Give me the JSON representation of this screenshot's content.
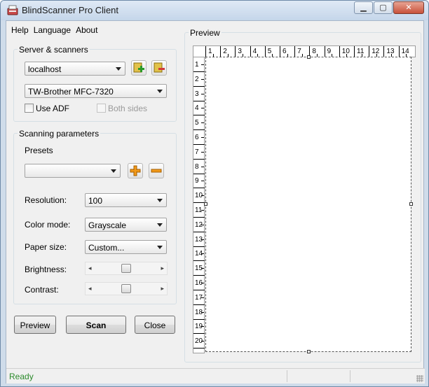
{
  "window": {
    "title": "BlindScanner Pro Client",
    "app_icon": "scanner-app-icon",
    "controls": {
      "minimize": "minimize-icon",
      "maximize": "maximize-icon",
      "close": "close-icon"
    }
  },
  "menu": {
    "items": [
      "Help",
      "Language",
      "About"
    ]
  },
  "server_group": {
    "title": "Server & scanners",
    "server_value": "localhost",
    "scanner_value": "TW-Brother MFC-7320",
    "add_server_icon": "add-server-icon",
    "remove_server_icon": "remove-server-icon",
    "use_adf_label": "Use ADF",
    "use_adf_checked": false,
    "both_sides_label": "Both sides",
    "both_sides_checked": false,
    "both_sides_enabled": false
  },
  "params_group": {
    "title": "Scanning parameters",
    "presets_label": "Presets",
    "preset_value": "",
    "add_preset_icon": "plus-icon",
    "remove_preset_icon": "minus-icon",
    "resolution_label": "Resolution:",
    "resolution_value": "100",
    "color_mode_label": "Color mode:",
    "color_mode_value": "Grayscale",
    "paper_size_label": "Paper size:",
    "paper_size_value": "Custom...",
    "brightness_label": "Brightness:",
    "brightness_level": 0.5,
    "contrast_label": "Contrast:",
    "contrast_level": 0.5
  },
  "buttons": {
    "preview": "Preview",
    "scan": "Scan",
    "close": "Close"
  },
  "preview": {
    "title": "Preview",
    "ruler_h": [
      "1",
      "2",
      "3",
      "4",
      "5",
      "6",
      "7",
      "8",
      "9",
      "10",
      "11",
      "12",
      "13",
      "14"
    ],
    "ruler_v": [
      "1",
      "2",
      "3",
      "4",
      "5",
      "6",
      "7",
      "8",
      "9",
      "10",
      "11",
      "12",
      "13",
      "14",
      "15",
      "16",
      "17",
      "18",
      "19",
      "20"
    ]
  },
  "status": {
    "text": "Ready",
    "color": "#2b8a2b"
  }
}
